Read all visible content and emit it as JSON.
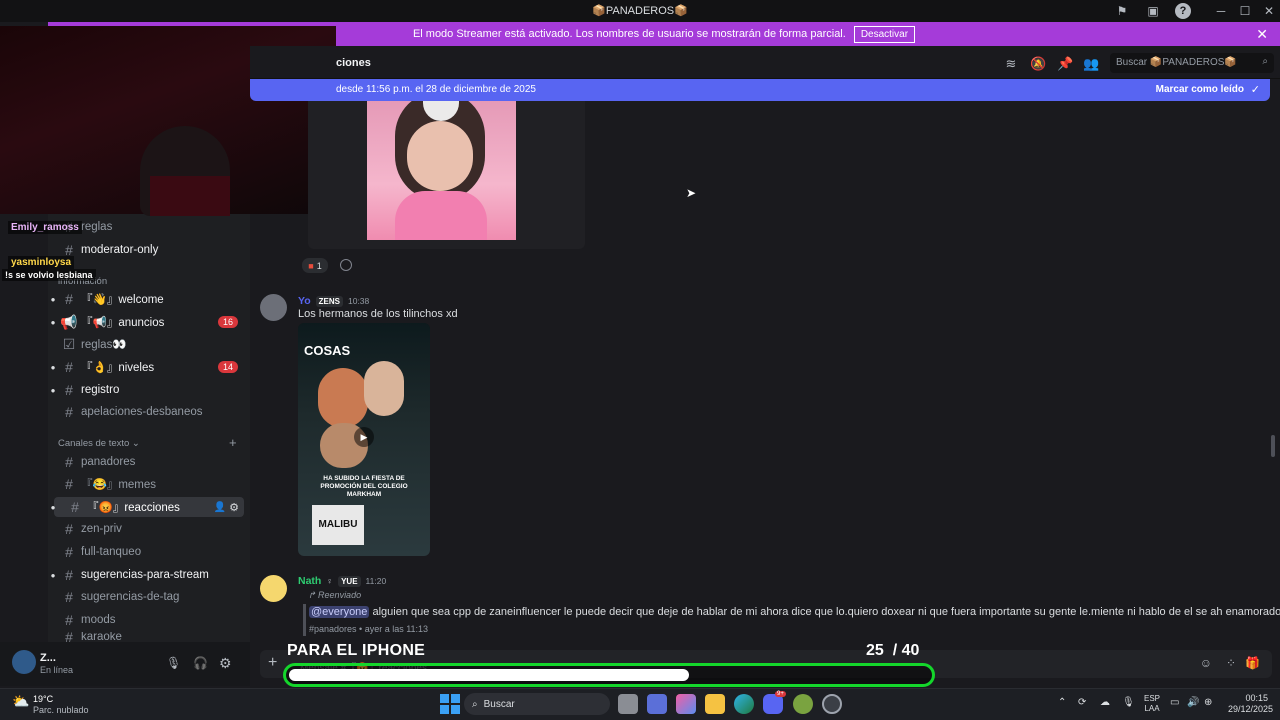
{
  "app": {
    "title": "📦PANADEROS📦"
  },
  "banner": {
    "text": "El modo Streamer está activado. Los nombres de usuario se mostrarán de forma parcial.",
    "button": "Desactivar"
  },
  "header": {
    "channel_partial": "ciones",
    "search_placeholder": "Buscar 📦PANADEROS📦"
  },
  "new_messages_bar": {
    "text": "desde 11:56 p.m. el 28 de diciembre de 2025",
    "action": "Marcar como leído"
  },
  "stream_chat": [
    {
      "name": "Emily_ramoss"
    },
    {
      "name": "yasminloysa",
      "message": "!s se volvio lesbiana"
    }
  ],
  "sidebar": {
    "partial_items": [
      "reglas",
      "moderator-only",
      "información"
    ],
    "items": [
      {
        "label": "『👋』welcome",
        "badge": ""
      },
      {
        "label": "『📢』anuncios",
        "badge": "16"
      },
      {
        "label": "reglas👀",
        "badge": ""
      },
      {
        "label": "『👌』niveles",
        "badge": "14"
      },
      {
        "label": "registro",
        "badge": ""
      },
      {
        "label": "apelaciones-desbaneos",
        "badge": ""
      }
    ],
    "category": "Canales de texto",
    "text_channels": [
      {
        "label": "panadores"
      },
      {
        "label": "『😂』memes"
      },
      {
        "label": "『😡』reacciones"
      },
      {
        "label": "zen-priv"
      },
      {
        "label": "full-tanqueo"
      },
      {
        "label": "sugerencias-para-stream"
      },
      {
        "label": "sugerencias-de-tag"
      },
      {
        "label": "moods"
      },
      {
        "label": "karaoke"
      }
    ]
  },
  "messages": {
    "reaction_count": "1",
    "msg1": {
      "user": "Yo",
      "tag": "ZENS",
      "time": "10:38",
      "text": "Los hermanos de los tilinchos xd",
      "video_title": "COSAS",
      "video_caption": "HA SUBIDO LA FIESTA DE PROMOCIÓN DEL COLEGIO MARKHAM",
      "video_shirt": "MALIBU"
    },
    "msg2": {
      "user": "Nath",
      "tag": "YUE",
      "time": "11:20",
      "forwarded": "Reenviado",
      "mention": "@everyone",
      "text": "alguien que sea cpp de zaneinfluencer  le puede decir que deje de hablar de mi ahora dice que lo.quiero doxear ni que fuera importante su gente le.miente ni hablo de el se ah enamorado creo",
      "origin": "#panadores  •  ayer a las 11:13"
    }
  },
  "user_panel": {
    "name": "Z...",
    "status": "En línea"
  },
  "input": {
    "placeholder": "Mensaje #『😡』reacciones"
  },
  "overlay": {
    "label": "PARA EL IPHONE",
    "current": "25",
    "goal": "/ 40",
    "progress": 0.625
  },
  "taskbar": {
    "weather_temp": "19°C",
    "weather_desc": "Parc. nublado",
    "search": "Buscar",
    "lang1": "ESP",
    "lang2": "LAA",
    "time": "00:15",
    "date": "29/12/2025",
    "discord_badge": "9+"
  }
}
